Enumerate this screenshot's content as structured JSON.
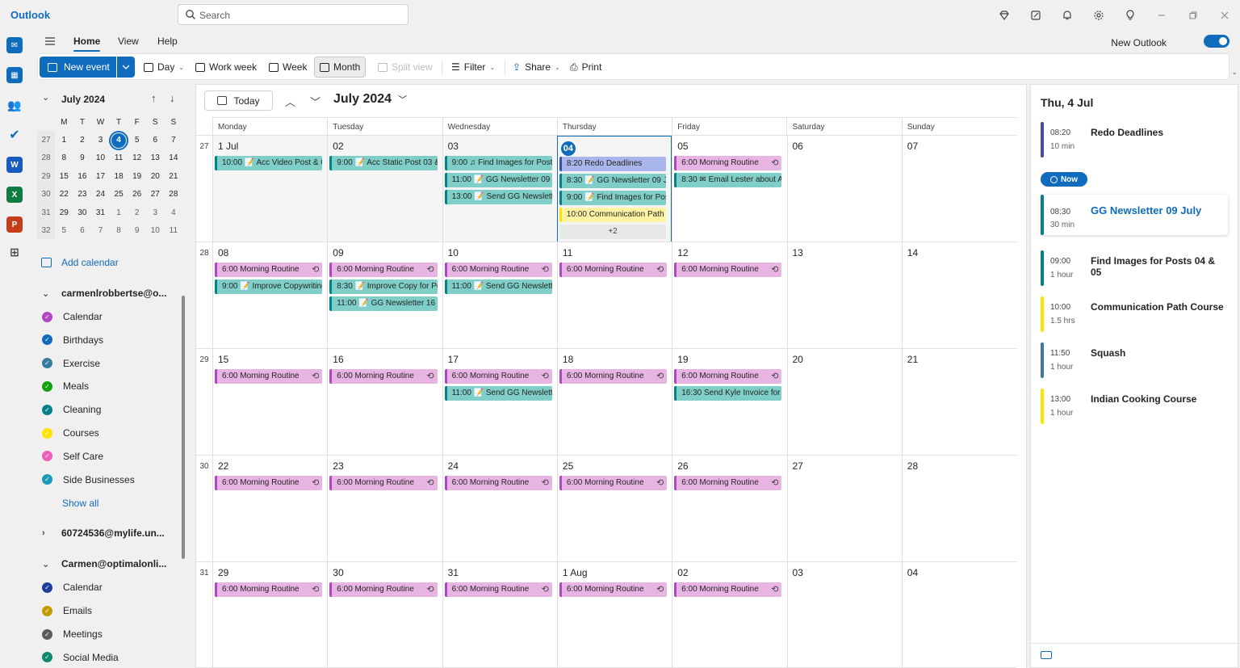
{
  "app": {
    "title": "Outlook"
  },
  "search": {
    "placeholder": "Search"
  },
  "ribbon_tabs": [
    "Home",
    "View",
    "Help"
  ],
  "new_outlook": {
    "label": "New Outlook",
    "enabled": true
  },
  "toolbar": {
    "new_event": "New event",
    "day": "Day",
    "work_week": "Work week",
    "week": "Week",
    "month": "Month",
    "split_view": "Split view",
    "filter": "Filter",
    "share": "Share",
    "print": "Print"
  },
  "mini_calendar": {
    "title": "July 2024",
    "weekday_heads": [
      "M",
      "T",
      "W",
      "T",
      "F",
      "S",
      "S"
    ],
    "weeks": [
      {
        "wk": "27",
        "days": [
          "1",
          "2",
          "3",
          "4",
          "5",
          "6",
          "7"
        ]
      },
      {
        "wk": "28",
        "days": [
          "8",
          "9",
          "10",
          "11",
          "12",
          "13",
          "14"
        ]
      },
      {
        "wk": "29",
        "days": [
          "15",
          "16",
          "17",
          "18",
          "19",
          "20",
          "21"
        ]
      },
      {
        "wk": "30",
        "days": [
          "22",
          "23",
          "24",
          "25",
          "26",
          "27",
          "28"
        ]
      },
      {
        "wk": "31",
        "days": [
          "29",
          "30",
          "31",
          "1",
          "2",
          "3",
          "4"
        ]
      },
      {
        "wk": "32",
        "days": [
          "5",
          "6",
          "7",
          "8",
          "9",
          "10",
          "11"
        ]
      }
    ],
    "today": "4"
  },
  "left_pane": {
    "add_calendar": "Add calendar",
    "show_all": "Show all",
    "accounts": [
      {
        "name": "carmenlrobbertse@o...",
        "expanded": true,
        "calendars": [
          {
            "name": "Calendar",
            "color": "#b146c2"
          },
          {
            "name": "Birthdays",
            "color": "#0f6cbd"
          },
          {
            "name": "Exercise",
            "color": "#3a7aa0"
          },
          {
            "name": "Meals",
            "color": "#13a10e"
          },
          {
            "name": "Cleaning",
            "color": "#038387"
          },
          {
            "name": "Courses",
            "color": "#fde300"
          },
          {
            "name": "Self Care",
            "color": "#ee5fb7"
          },
          {
            "name": "Side Businesses",
            "color": "#1c9bb8"
          }
        ]
      },
      {
        "name": "60724536@mylife.un...",
        "expanded": false,
        "calendars": []
      },
      {
        "name": "Carmen@optimalonli...",
        "expanded": true,
        "calendars": [
          {
            "name": "Calendar",
            "color": "#1f3e9c"
          },
          {
            "name": "Emails",
            "color": "#c19c00"
          },
          {
            "name": "Meetings",
            "color": "#5c5c5c"
          },
          {
            "name": "Social Media",
            "color": "#0b8a6e"
          }
        ]
      }
    ]
  },
  "main": {
    "today_label": "Today",
    "month_title": "July 2024",
    "day_heads": [
      "Monday",
      "Tuesday",
      "Wednesday",
      "Thursday",
      "Friday",
      "Saturday",
      "Sunday"
    ],
    "weeks": [
      {
        "wk": "27",
        "days": [
          {
            "label": "1 Jul",
            "past": true,
            "events": [
              {
                "text": "10:00 📝 Acc Video Post & 01",
                "color": "teal"
              }
            ]
          },
          {
            "label": "02",
            "past": true,
            "events": [
              {
                "text": "9:00 📝 Acc Static Post 03 & 0",
                "color": "teal"
              }
            ]
          },
          {
            "label": "03",
            "past": true,
            "events": [
              {
                "text": "9:00 ♫ Find Images for Post",
                "color": "teal"
              },
              {
                "text": "11:00 📝 GG Newsletter 09 Ju",
                "color": "teal"
              },
              {
                "text": "13:00 📝 Send GG Newsletter",
                "color": "teal"
              }
            ]
          },
          {
            "label": "04",
            "today": true,
            "events": [
              {
                "text": "8:20 Redo Deadlines",
                "color": "blue"
              },
              {
                "text": "8:30 📝 GG Newsletter 09 Jul",
                "color": "teal"
              },
              {
                "text": "9:00 📝 Find Images for Post",
                "color": "teal"
              },
              {
                "text": "10:00 Communication Path C",
                "color": "yellow"
              }
            ],
            "more": "+2"
          },
          {
            "label": "05",
            "events": [
              {
                "text": "6:00 Morning Routine",
                "color": "pink",
                "repeat": true
              },
              {
                "text": "8:30 ✉ Email Lester about A",
                "color": "teal"
              }
            ]
          },
          {
            "label": "06",
            "events": []
          },
          {
            "label": "07",
            "events": []
          }
        ]
      },
      {
        "wk": "28",
        "days": [
          {
            "label": "08",
            "events": [
              {
                "text": "6:00 Morning Routine",
                "color": "pink",
                "repeat": true
              },
              {
                "text": "9:00 📝 Improve Copywriting",
                "color": "teal"
              }
            ]
          },
          {
            "label": "09",
            "events": [
              {
                "text": "6:00 Morning Routine",
                "color": "pink",
                "repeat": true
              },
              {
                "text": "8:30 📝 Improve Copy for Po",
                "color": "teal"
              },
              {
                "text": "11:00 📝 GG Newsletter 16 Ju",
                "color": "teal"
              }
            ]
          },
          {
            "label": "10",
            "events": [
              {
                "text": "6:00 Morning Routine",
                "color": "pink",
                "repeat": true
              },
              {
                "text": "11:00 📝 Send GG Newsletter",
                "color": "teal"
              }
            ]
          },
          {
            "label": "11",
            "events": [
              {
                "text": "6:00 Morning Routine",
                "color": "pink",
                "repeat": true
              }
            ]
          },
          {
            "label": "12",
            "events": [
              {
                "text": "6:00 Morning Routine",
                "color": "pink",
                "repeat": true
              }
            ]
          },
          {
            "label": "13",
            "events": []
          },
          {
            "label": "14",
            "events": []
          }
        ]
      },
      {
        "wk": "29",
        "days": [
          {
            "label": "15",
            "events": [
              {
                "text": "6:00 Morning Routine",
                "color": "pink",
                "repeat": true
              }
            ]
          },
          {
            "label": "16",
            "events": [
              {
                "text": "6:00 Morning Routine",
                "color": "pink",
                "repeat": true
              }
            ]
          },
          {
            "label": "17",
            "events": [
              {
                "text": "6:00 Morning Routine",
                "color": "pink",
                "repeat": true
              },
              {
                "text": "11:00 📝 Send GG Newsletter",
                "color": "teal"
              }
            ]
          },
          {
            "label": "18",
            "events": [
              {
                "text": "6:00 Morning Routine",
                "color": "pink",
                "repeat": true
              }
            ]
          },
          {
            "label": "19",
            "events": [
              {
                "text": "6:00 Morning Routine",
                "color": "pink",
                "repeat": true
              },
              {
                "text": "16:30 Send Kyle Invoice for J",
                "color": "teal"
              }
            ]
          },
          {
            "label": "20",
            "events": []
          },
          {
            "label": "21",
            "events": []
          }
        ]
      },
      {
        "wk": "30",
        "days": [
          {
            "label": "22",
            "events": [
              {
                "text": "6:00 Morning Routine",
                "color": "pink",
                "repeat": true
              }
            ]
          },
          {
            "label": "23",
            "events": [
              {
                "text": "6:00 Morning Routine",
                "color": "pink",
                "repeat": true
              }
            ]
          },
          {
            "label": "24",
            "events": [
              {
                "text": "6:00 Morning Routine",
                "color": "pink",
                "repeat": true
              }
            ]
          },
          {
            "label": "25",
            "events": [
              {
                "text": "6:00 Morning Routine",
                "color": "pink",
                "repeat": true
              }
            ]
          },
          {
            "label": "26",
            "events": [
              {
                "text": "6:00 Morning Routine",
                "color": "pink",
                "repeat": true
              }
            ]
          },
          {
            "label": "27",
            "events": []
          },
          {
            "label": "28",
            "events": []
          }
        ]
      },
      {
        "wk": "31",
        "days": [
          {
            "label": "29",
            "events": [
              {
                "text": "6:00 Morning Routine",
                "color": "pink",
                "repeat": true
              }
            ]
          },
          {
            "label": "30",
            "events": [
              {
                "text": "6:00 Morning Routine",
                "color": "pink",
                "repeat": true
              }
            ]
          },
          {
            "label": "31",
            "events": [
              {
                "text": "6:00 Morning Routine",
                "color": "pink",
                "repeat": true
              }
            ]
          },
          {
            "label": "1 Aug",
            "events": [
              {
                "text": "6:00 Morning Routine",
                "color": "pink",
                "repeat": true
              }
            ]
          },
          {
            "label": "02",
            "events": [
              {
                "text": "6:00 Morning Routine",
                "color": "pink",
                "repeat": true
              }
            ]
          },
          {
            "label": "03",
            "events": []
          },
          {
            "label": "04",
            "events": []
          }
        ]
      }
    ]
  },
  "right_pane": {
    "title": "Thu, 4 Jul",
    "now_label": "Now",
    "agenda": [
      {
        "time": "08:20",
        "duration": "10 min",
        "title": "Redo Deadlines",
        "color": "#3f4ea8"
      },
      {
        "time": "08:30",
        "duration": "30 min",
        "title": "GG Newsletter 09 July",
        "color": "#038387",
        "selected": true
      },
      {
        "time": "09:00",
        "duration": "1 hour",
        "title": "Find Images for Posts 04 & 05",
        "color": "#038387"
      },
      {
        "time": "10:00",
        "duration": "1.5 hrs",
        "title": "Communication Path Course",
        "color": "#fde300"
      },
      {
        "time": "11:50",
        "duration": "1 hour",
        "title": "Squash",
        "color": "#3a7aa0"
      },
      {
        "time": "13:00",
        "duration": "1 hour",
        "title": "Indian Cooking Course",
        "color": "#fde300"
      }
    ]
  }
}
